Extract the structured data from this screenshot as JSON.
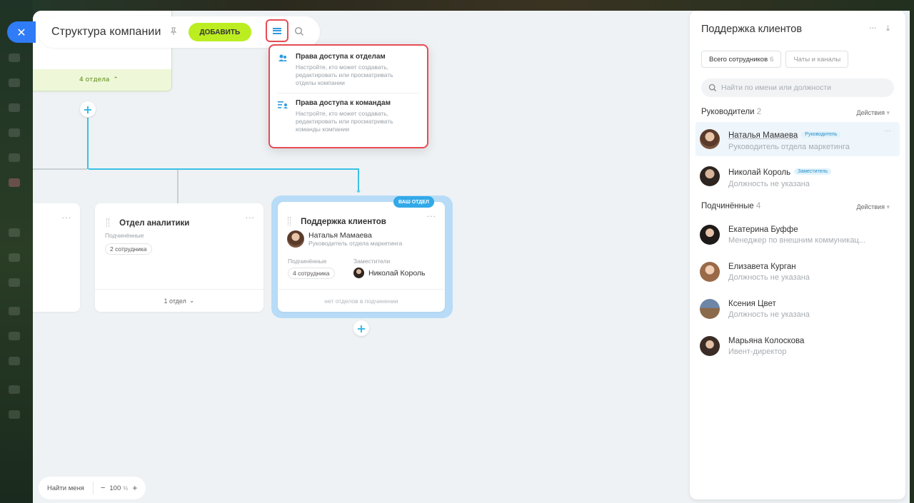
{
  "page": {
    "title": "Структура компании",
    "add_label": "ДОБАВИТЬ"
  },
  "menu": {
    "items": [
      {
        "title": "Права доступа к отделам",
        "desc": "Настройте, кто может создавать, редактировать или просматривать отделы компании",
        "icon": "users-icon"
      },
      {
        "title": "Права доступа к командам",
        "desc": "Настройте, кто может создавать, редактировать или просматривать команды компании",
        "icon": "team-list-icon"
      }
    ]
  },
  "tree": {
    "top_card_footer": "4 отдела",
    "cards": [
      {
        "title": "Отдел аналитики",
        "sub_label": "Подчинённые",
        "sub_value": "2 сотрудника",
        "footer": "1 отдел"
      },
      {
        "title": "Поддержка клиентов",
        "badge": "ВАШ ОТДЕЛ",
        "head_name": "Наталья Мамаева",
        "head_role": "Руководитель отдела маркетинга",
        "sub_label": "Подчинённые",
        "sub_value": "4 сотрудника",
        "dep_label": "Заместители",
        "dep_name": "Николай Король",
        "footer": "нет отделов в подчинении"
      }
    ]
  },
  "bottom": {
    "find_me": "Найти меня",
    "minus": "−",
    "zoom": "100",
    "zoom_unit": "%",
    "plus": "+"
  },
  "panel": {
    "title": "Поддержка клиентов",
    "tabs": [
      {
        "label": "Всего сотрудников",
        "count": "6"
      },
      {
        "label": "Чаты и каналы"
      }
    ],
    "search_placeholder": "Найти по имени или должности",
    "managers": {
      "label": "Руководители",
      "count": "2",
      "actions": "Действия",
      "people": [
        {
          "name": "Наталья Мамаева",
          "tag": "Руководитель",
          "role": "Руководитель отдела маркетинга"
        },
        {
          "name": "Николай Король",
          "tag": "Заместитель",
          "role": "Должность не указана"
        }
      ]
    },
    "subordinates": {
      "label": "Подчинённые",
      "count": "4",
      "actions": "Действия",
      "people": [
        {
          "name": "Екатерина Буффе",
          "role": "Менеджер по внешним коммуникац..."
        },
        {
          "name": "Елизавета Курган",
          "role": "Должность не указана"
        },
        {
          "name": "Ксения Цвет",
          "role": "Должность не указана"
        },
        {
          "name": "Марьяна Колоскова",
          "role": "Ивент-директор"
        }
      ]
    }
  }
}
